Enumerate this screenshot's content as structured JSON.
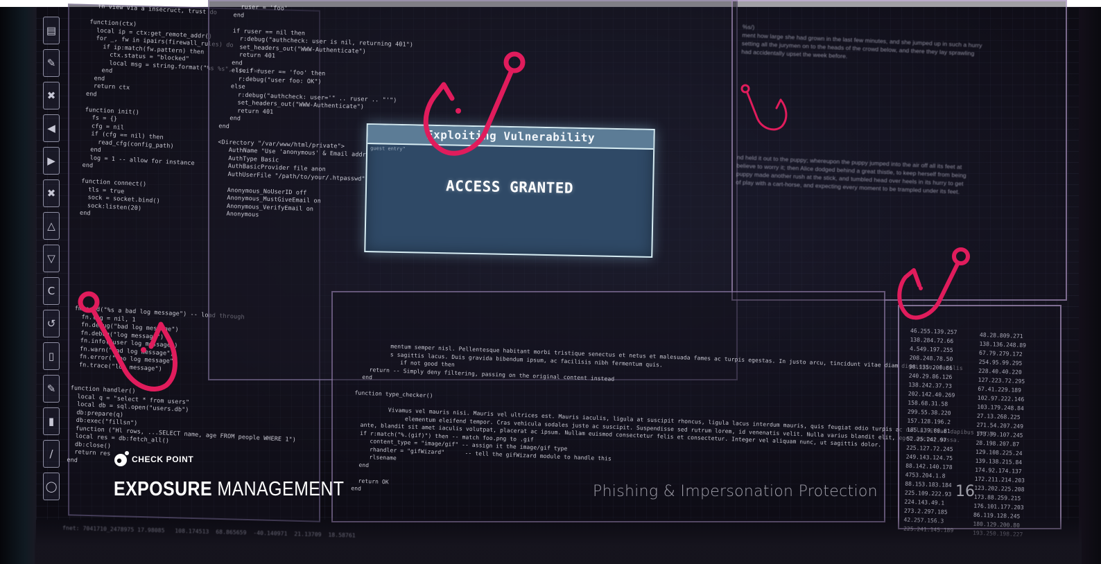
{
  "dialog": {
    "title": "Exploiting Vulnerability",
    "message": "ACCESS GRANTED",
    "hint": "guest entry\""
  },
  "brand": {
    "company": "CHECK POINT",
    "product_bold": "EXPOSURE",
    "product_light": "MANAGEMENT"
  },
  "footer": {
    "title": "Phishing & Impersonation Protection",
    "page": "16"
  },
  "dock": {
    "icons": [
      "document-icon",
      "pen-icon",
      "close-icon",
      "back-icon",
      "play-icon",
      "close-icon",
      "triangle-icon",
      "down-triangle-icon",
      "c-icon",
      "refresh-icon",
      "pipe-icon",
      "pencil-icon",
      "bar-icon",
      "slash-icon",
      "circle-icon"
    ],
    "glyphs": [
      "▤",
      "✎",
      "✖",
      "◀",
      "▶",
      "✖",
      "△",
      "▽",
      "C",
      "↺",
      "▯",
      "✎",
      "▮",
      "/",
      "◯"
    ]
  },
  "colors": {
    "hook": "#e01c5c",
    "dialog_bg": "#2f4966",
    "dialog_title_bg": "#5c7c96",
    "background": "#0b0a10"
  }
}
